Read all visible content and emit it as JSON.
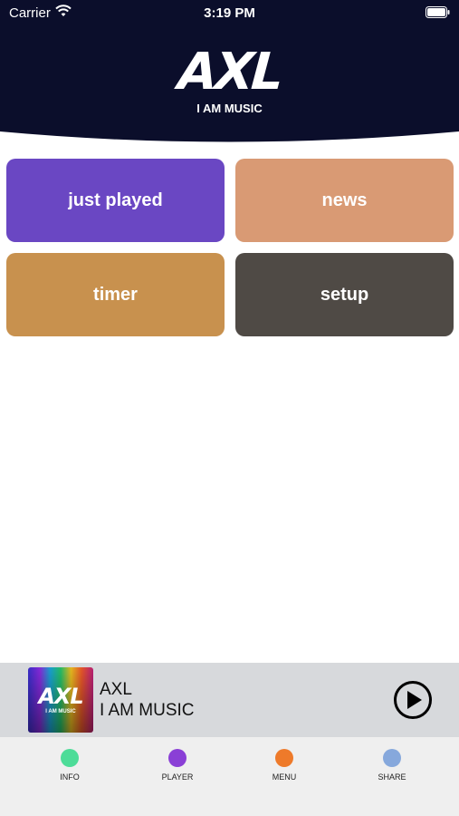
{
  "status_bar": {
    "carrier": "Carrier",
    "time": "3:19 PM"
  },
  "header": {
    "logo_main": "AXL",
    "logo_sub": "I AM MUSIC",
    "background_color": "#0b0e2b"
  },
  "tiles": [
    {
      "label": "just played",
      "color": "#6a47c3"
    },
    {
      "label": "news",
      "color": "#d99a74"
    },
    {
      "label": "timer",
      "color": "#c8914e"
    },
    {
      "label": "setup",
      "color": "#4f4a45"
    }
  ],
  "now_playing": {
    "art_text": "AXL",
    "art_sub": "I AM MUSIC",
    "title": "AXL",
    "subtitle": "I AM MUSIC",
    "play_icon": "play-circle-icon"
  },
  "tab_bar": {
    "tabs": [
      {
        "label": "INFO",
        "color": "#4ddc98"
      },
      {
        "label": "PLAYER",
        "color": "#8a3fd6"
      },
      {
        "label": "MENU",
        "color": "#ee7a2a"
      },
      {
        "label": "SHARE",
        "color": "#86a8dc"
      }
    ]
  }
}
